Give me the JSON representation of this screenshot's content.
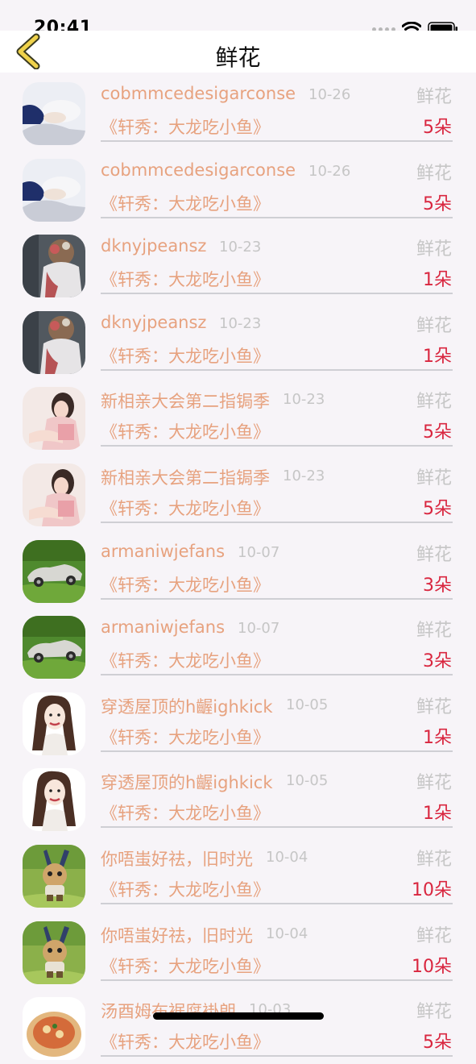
{
  "status": {
    "time": "20:41"
  },
  "nav": {
    "title": "鲜花"
  },
  "rows": [
    {
      "name": "cobmmcedesigarconse",
      "date": "10-26",
      "kind": "鲜花",
      "show": "《轩秀：大龙吃小鱼》",
      "count": "5朵",
      "avatar": "man-icon"
    },
    {
      "name": "cobmmcedesigarconse",
      "date": "10-26",
      "kind": "鲜花",
      "show": "《轩秀：大龙吃小鱼》",
      "count": "5朵",
      "avatar": "man-icon"
    },
    {
      "name": "dknyjpeansz",
      "date": "10-23",
      "kind": "鲜花",
      "show": "《轩秀：大龙吃小鱼》",
      "count": "1朵",
      "avatar": "girl-back-icon"
    },
    {
      "name": "dknyjpeansz",
      "date": "10-23",
      "kind": "鲜花",
      "show": "《轩秀：大龙吃小鱼》",
      "count": "1朵",
      "avatar": "girl-back-icon"
    },
    {
      "name": "新相亲大会第二指锔季",
      "date": "10-23",
      "kind": "鲜花",
      "show": "《轩秀：大龙吃小鱼》",
      "count": "5朵",
      "avatar": "girl-icon"
    },
    {
      "name": "新相亲大会第二指锔季",
      "date": "10-23",
      "kind": "鲜花",
      "show": "《轩秀：大龙吃小鱼》",
      "count": "5朵",
      "avatar": "girl-icon"
    },
    {
      "name": "armaniwjefans",
      "date": "10-07",
      "kind": "鲜花",
      "show": "《轩秀：大龙吃小鱼》",
      "count": "3朵",
      "avatar": "car-icon"
    },
    {
      "name": "armaniwjefans",
      "date": "10-07",
      "kind": "鲜花",
      "show": "《轩秀：大龙吃小鱼》",
      "count": "3朵",
      "avatar": "car-icon"
    },
    {
      "name": "穿透屋顶的h齷ighkick",
      "date": "10-05",
      "kind": "鲜花",
      "show": "《轩秀：大龙吃小鱼》",
      "count": "1朵",
      "avatar": "drawn-girl-icon"
    },
    {
      "name": "穿透屋顶的h齷ighkick",
      "date": "10-05",
      "kind": "鲜花",
      "show": "《轩秀：大龙吃小鱼》",
      "count": "1朵",
      "avatar": "drawn-girl-icon"
    },
    {
      "name": "你唔蚩好祛，旧时光",
      "date": "10-04",
      "kind": "鲜花",
      "show": "《轩秀：大龙吃小鱼》",
      "count": "10朵",
      "avatar": "rabbit-icon"
    },
    {
      "name": "你唔蚩好祛，旧时光",
      "date": "10-04",
      "kind": "鲜花",
      "show": "《轩秀：大龙吃小鱼》",
      "count": "10朵",
      "avatar": "rabbit-icon"
    },
    {
      "name": "汤酉姆布裾腐褂朗",
      "date": "10-03",
      "kind": "鲜花",
      "show": "《轩秀：大龙吃小鱼》",
      "count": "5朵",
      "avatar": "food-icon"
    }
  ]
}
